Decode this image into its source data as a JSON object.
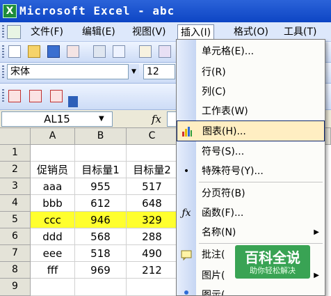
{
  "window": {
    "title": "Microsoft Excel - abc",
    "icon": "excel-icon"
  },
  "menubar": {
    "items": [
      {
        "label": "文件(F)"
      },
      {
        "label": "编辑(E)"
      },
      {
        "label": "视图(V)"
      },
      {
        "label": "插入(I)"
      },
      {
        "label": "格式(O)"
      },
      {
        "label": "工具(T)"
      }
    ]
  },
  "toolbar": {
    "font_name": "宋体",
    "font_size": "12"
  },
  "formula_bar": {
    "name_box": "AL15",
    "fx": "fx"
  },
  "sheet": {
    "columns": [
      "A",
      "B",
      "C"
    ],
    "rows": [
      "1",
      "2",
      "3",
      "4",
      "5",
      "6",
      "7",
      "8",
      "9"
    ],
    "cells": [
      [
        "",
        "",
        ""
      ],
      [
        "促销员",
        "目标量1",
        "目标量2"
      ],
      [
        "aaa",
        "955",
        "517"
      ],
      [
        "bbb",
        "612",
        "648"
      ],
      [
        "ccc",
        "946",
        "329"
      ],
      [
        "ddd",
        "568",
        "288"
      ],
      [
        "eee",
        "518",
        "490"
      ],
      [
        "fff",
        "969",
        "212"
      ],
      [
        "",
        "",
        ""
      ]
    ],
    "highlight_row": 5,
    "highlight_color": "#ffff2e"
  },
  "insert_menu": {
    "items": [
      {
        "label": "单元格(E)...",
        "icon": ""
      },
      {
        "label": "行(R)",
        "icon": ""
      },
      {
        "label": "列(C)",
        "icon": ""
      },
      {
        "label": "工作表(W)",
        "icon": ""
      },
      {
        "label": "图表(H)...",
        "icon": "chart-icon"
      },
      {
        "label": "符号(S)...",
        "icon": ""
      },
      {
        "label": "特殊符号(Y)...",
        "icon": "dot-icon"
      },
      {
        "label": "分页符(B)",
        "icon": ""
      },
      {
        "label": "函数(F)...",
        "icon": "function-icon"
      },
      {
        "label": "名称(N)",
        "icon": ""
      },
      {
        "label": "批注(",
        "icon": "comment-icon"
      },
      {
        "label": "图片(",
        "icon": ""
      },
      {
        "label": "图示(",
        "icon": "diagram-icon"
      }
    ],
    "selected_label": "图表(H)...",
    "accent": "#0a246a"
  },
  "watermark": {
    "main": "百科全说",
    "sub": "助你轻松解决"
  }
}
